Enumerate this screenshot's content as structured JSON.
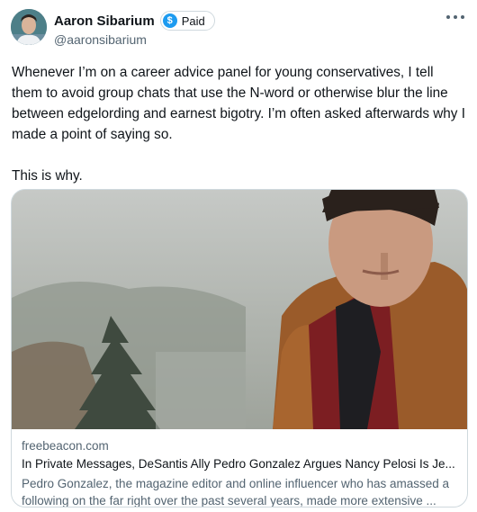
{
  "author": {
    "display_name": "Aaron Sibarium",
    "badge_label": "Paid",
    "badge_icon": "dollar-badge-icon",
    "handle": "@aaronsibarium"
  },
  "tweet": {
    "text": "Whenever I’m on a career advice panel for young conservatives, I tell them to avoid group chats that use the N-word or otherwise blur the line between edgelording and earnest bigotry. I’m often asked afterwards why I made a point of saying so.\n\nThis is why."
  },
  "link_card": {
    "domain": "freebeacon.com",
    "title": "In Private Messages, DeSantis Ally Pedro Gonzalez Argues Nancy Pelosi Is Je...",
    "description": "Pedro Gonzalez, the magazine editor and online influencer who has amassed a following on the far right over the past several years, made more extensive ..."
  },
  "colors": {
    "text_primary": "#0f1419",
    "text_secondary": "#536471",
    "border": "#cfd9de",
    "accent": "#1d9bf0"
  }
}
